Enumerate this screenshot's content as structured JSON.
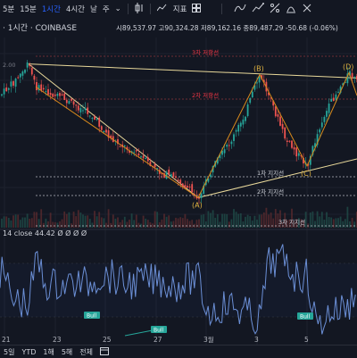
{
  "toolbar": {
    "intervals": [
      "5분",
      "15분",
      "1시간",
      "4시간",
      "날",
      "주"
    ],
    "active_interval": "1시간",
    "chevron": "⌄",
    "candle_icon": "candles-icon",
    "indicator_label": "지표",
    "grid_icon": "layout-grid-icon",
    "right_icons": [
      "drawing-tool-icon",
      "trend-icon",
      "compare-icon",
      "chart-style-icon",
      "replay-icon"
    ]
  },
  "symbol_bar": {
    "title": "· 1시간 · COINBASE",
    "ohlc_text": "시89,537.97  고90,324.28  저89,162.16  종89,487.29  -50.68 (-0.06%)",
    "price_tag": "2.00"
  },
  "rsi_legend": "14 close  44.42  Ø Ø Ø Ø",
  "chart_data": [
    {
      "type": "candlestick",
      "title": "· 1시간 · COINBASE",
      "ohlc": {
        "open": 89537.97,
        "high": 90324.28,
        "low": 89162.16,
        "close": 89487.29,
        "change": -50.68,
        "change_pct": -0.06
      },
      "x_ticks": [
        "21",
        "23",
        "25",
        "27",
        "3월",
        "3",
        "5"
      ],
      "pivots": [
        {
          "label": "(A)",
          "price_level": 0.88
        },
        {
          "label": "(B)",
          "price_level": 0.18
        },
        {
          "label": "(C)",
          "price_level": 0.7
        },
        {
          "label": "(D)",
          "price_level": 0.17
        }
      ],
      "horizontal_levels": [
        {
          "label": "3차 저항선",
          "color": "#f23645"
        },
        {
          "label": "2차 저항선",
          "color": "#f23645"
        },
        {
          "label": "1차 지지선",
          "color": "#d1d4dc"
        },
        {
          "label": "2차 지지선",
          "color": "#d1d4dc"
        },
        {
          "label": "3차 지지선",
          "color": "#d1d4dc"
        }
      ],
      "series_colors": {
        "up": "#26a69a",
        "down": "#ef5350",
        "trendline": "#e8d89a",
        "wave": "#d98a1c"
      }
    },
    {
      "type": "line",
      "title": "14 close",
      "value": 44.42,
      "annotations": [
        "Bull",
        "Bull",
        "Bull"
      ],
      "series_colors": {
        "rsi": "#6b8fd6"
      }
    }
  ]
}
